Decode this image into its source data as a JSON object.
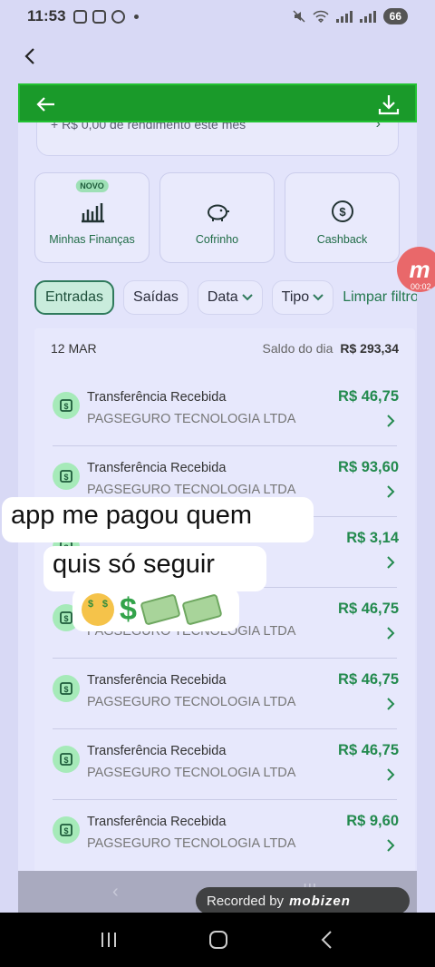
{
  "status_bar": {
    "time": "11:53",
    "battery": "66"
  },
  "header": {
    "back_icon": "chevron-left-icon"
  },
  "inner_header": {
    "back_icon": "arrow-left-icon",
    "download_icon": "download-icon"
  },
  "balance": {
    "text": "+ R$ 0,00 de rendimento este mês"
  },
  "tiles": [
    {
      "label": "Minhas Finanças",
      "badge": "NOVO",
      "icon": "chart-bars-icon"
    },
    {
      "label": "Cofrinho",
      "icon": "piggy-bank-icon"
    },
    {
      "label": "Cashback",
      "icon": "cashback-icon"
    }
  ],
  "filters": {
    "entradas": "Entradas",
    "saidas": "Saídas",
    "data": "Data",
    "tipo": "Tipo",
    "clear": "Limpar filtros"
  },
  "recording_badge": {
    "letter": "m",
    "time": "00:02"
  },
  "day": {
    "date": "12 MAR",
    "saldo_label": "Saldo do dia",
    "saldo_value": "R$ 293,34"
  },
  "transactions": [
    {
      "title": "Transferência Recebida",
      "subtitle": "PAGSEGURO TECNOLOGIA LTDA",
      "amount": "R$ 46,75"
    },
    {
      "title": "Transferência Recebida",
      "subtitle": "PAGSEGURO TECNOLOGIA LTDA",
      "amount": "R$ 93,60"
    },
    {
      "title": "",
      "subtitle": "",
      "amount": "R$ 3,14"
    },
    {
      "title": "",
      "subtitle": "PAGSEGURO TECNOLOGIA LTDA",
      "amount": "R$ 46,75"
    },
    {
      "title": "Transferência Recebida",
      "subtitle": "PAGSEGURO TECNOLOGIA LTDA",
      "amount": "R$ 46,75"
    },
    {
      "title": "Transferência Recebida",
      "subtitle": "PAGSEGURO TECNOLOGIA LTDA",
      "amount": "R$ 46,75"
    },
    {
      "title": "Transferência Recebida",
      "subtitle": "PAGSEGURO TECNOLOGIA LTDA",
      "amount": "R$ 9,60"
    }
  ],
  "caption": {
    "line1": "app me pagou quem",
    "line2": "quis só seguir"
  },
  "recorded": {
    "label": "Recorded by",
    "brand": "mobizen"
  }
}
